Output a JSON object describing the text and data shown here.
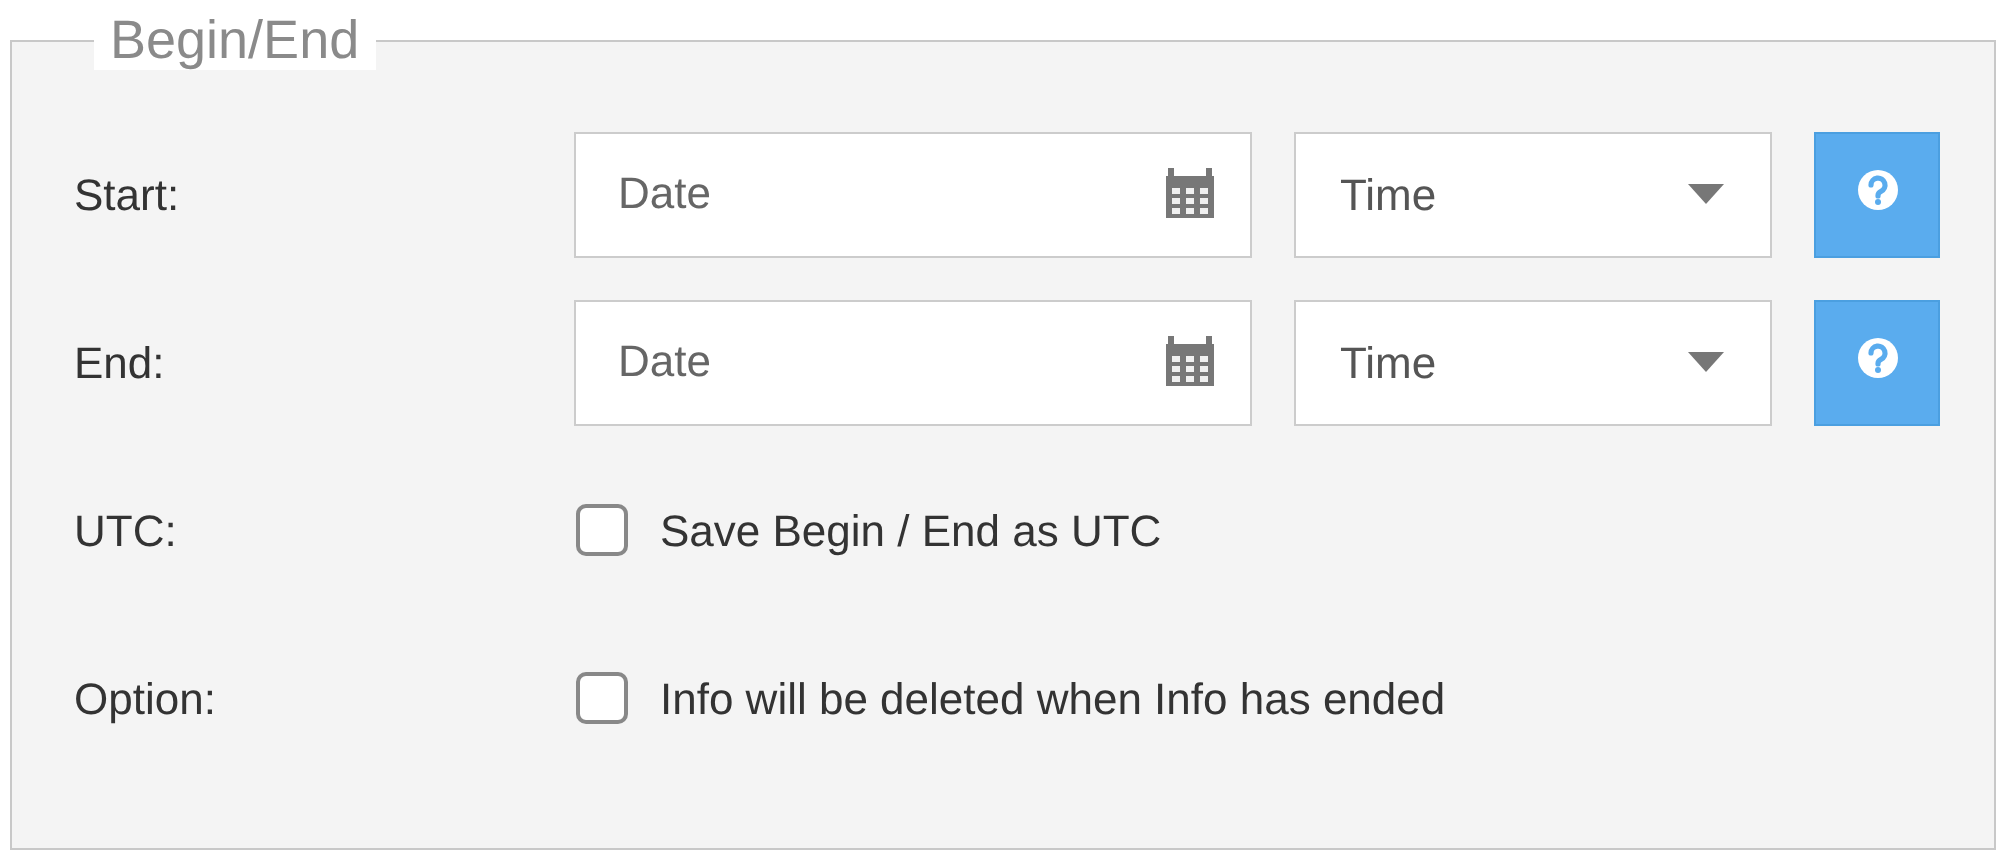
{
  "fieldset": {
    "legend": "Begin/End"
  },
  "rows": [
    {
      "kind": "datetime",
      "label": "Start:",
      "date_placeholder": "Date",
      "time_placeholder": "Time"
    },
    {
      "kind": "datetime",
      "label": "End:",
      "date_placeholder": "Date",
      "time_placeholder": "Time"
    },
    {
      "kind": "checkbox",
      "label": "UTC:",
      "text": "Save Begin / End as UTC",
      "checked": false
    },
    {
      "kind": "checkbox",
      "label": "Option:",
      "text": "Info will be deleted when Info has ended",
      "checked": false
    }
  ]
}
